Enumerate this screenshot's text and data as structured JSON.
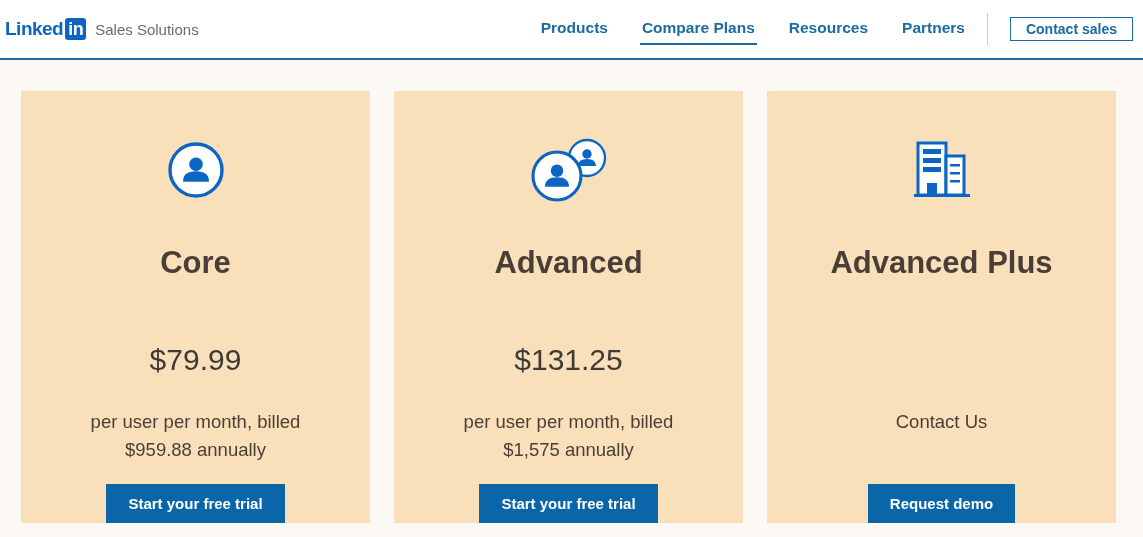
{
  "header": {
    "logo": {
      "word": "Linked",
      "badge": "in"
    },
    "product": "Sales Solutions",
    "nav": [
      {
        "label": "Products",
        "selected": false
      },
      {
        "label": "Compare Plans",
        "selected": true
      },
      {
        "label": "Resources",
        "selected": false
      },
      {
        "label": "Partners",
        "selected": false
      }
    ],
    "cta": "Contact sales"
  },
  "plans": [
    {
      "name": "Core",
      "price": "$79.99",
      "description": [
        "per user per month, billed",
        "$959.88 annually"
      ],
      "button": "Start your free trial"
    },
    {
      "name": "Advanced",
      "price": "$131.25",
      "description": [
        "per user per month, billed",
        "$1,575 annually"
      ],
      "button": "Start your free trial"
    },
    {
      "name": "Advanced Plus",
      "description": [
        "Contact Us"
      ],
      "button": "Request demo"
    }
  ]
}
